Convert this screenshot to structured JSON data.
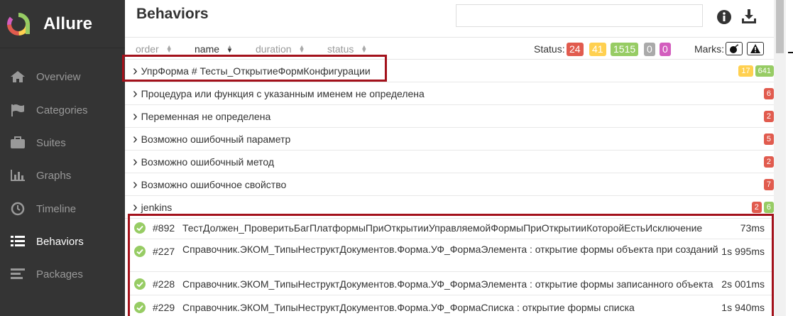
{
  "app": {
    "name": "Allure"
  },
  "sidebar": {
    "items": [
      {
        "label": "Overview",
        "icon": "home-icon"
      },
      {
        "label": "Categories",
        "icon": "flag-icon"
      },
      {
        "label": "Suites",
        "icon": "briefcase-icon"
      },
      {
        "label": "Graphs",
        "icon": "bar-chart-icon"
      },
      {
        "label": "Timeline",
        "icon": "clock-icon"
      },
      {
        "label": "Behaviors",
        "icon": "list-icon",
        "active": true
      },
      {
        "label": "Packages",
        "icon": "align-left-icon"
      }
    ]
  },
  "header": {
    "title": "Behaviors",
    "search_value": ""
  },
  "sort": {
    "columns": [
      {
        "label": "order"
      },
      {
        "label": "name",
        "active": true
      },
      {
        "label": "duration"
      },
      {
        "label": "status"
      }
    ]
  },
  "status_filter": {
    "label": "Status:",
    "counts": [
      {
        "value": "24",
        "color": "#e15b4e"
      },
      {
        "value": "41",
        "color": "#ffd050"
      },
      {
        "value": "1515",
        "color": "#97cc64"
      },
      {
        "value": "0",
        "color": "#aaaaaa"
      },
      {
        "value": "0",
        "color": "#d35ebe"
      }
    ]
  },
  "marks": {
    "label": "Marks:",
    "icons": [
      "bomb-icon",
      "warning-icon"
    ]
  },
  "groups": [
    {
      "label": "УпрФорма # Тесты_ОткрытиеФормКонфигурации",
      "counts": [
        {
          "value": "17",
          "color": "#ffd050"
        },
        {
          "value": "641",
          "color": "#97cc64"
        }
      ]
    },
    {
      "label": "Процедура или функция с указанным именем не определена",
      "counts": [
        {
          "value": "6",
          "color": "#e15b4e"
        }
      ]
    },
    {
      "label": "Переменная не определена",
      "counts": [
        {
          "value": "2",
          "color": "#e15b4e"
        }
      ]
    },
    {
      "label": "Возможно ошибочный параметр",
      "counts": [
        {
          "value": "5",
          "color": "#e15b4e"
        }
      ]
    },
    {
      "label": "Возможно ошибочный метод",
      "counts": [
        {
          "value": "2",
          "color": "#e15b4e"
        }
      ]
    },
    {
      "label": "Возможно ошибочное свойство",
      "counts": [
        {
          "value": "7",
          "color": "#e15b4e"
        }
      ]
    },
    {
      "label": "jenkins",
      "counts": [
        {
          "value": "2",
          "color": "#e15b4e"
        },
        {
          "value": "6",
          "color": "#97cc64"
        }
      ]
    }
  ],
  "tests": [
    {
      "num": "#892",
      "name": "ТестДолжен_ПроверитьБагПлатформыПриОткрытииУправляемойФормыПриОткрытииКоторойЕстьИсключение",
      "duration": "73ms"
    },
    {
      "num": "#227",
      "name": "Справочник.ЭКОМ_ТипыНеструктДокументов.Форма.УФ_ФормаЭлемента : открытие формы объекта при созданий",
      "duration": "1s 995ms"
    },
    {
      "num": "#228",
      "name": "Справочник.ЭКОМ_ТипыНеструктДокументов.Форма.УФ_ФормаЭлемента : открытие формы записанного объекта",
      "duration": "2s 001ms"
    },
    {
      "num": "#229",
      "name": "Справочник.ЭКОМ_ТипыНеструктДокументов.Форма.УФ_ФормаСписка : открытие формы списка",
      "duration": "1s 940ms"
    }
  ],
  "colors": {
    "sidebar_bg": "#343434",
    "highlight": "#a3111b",
    "passed": "#97cc64"
  }
}
